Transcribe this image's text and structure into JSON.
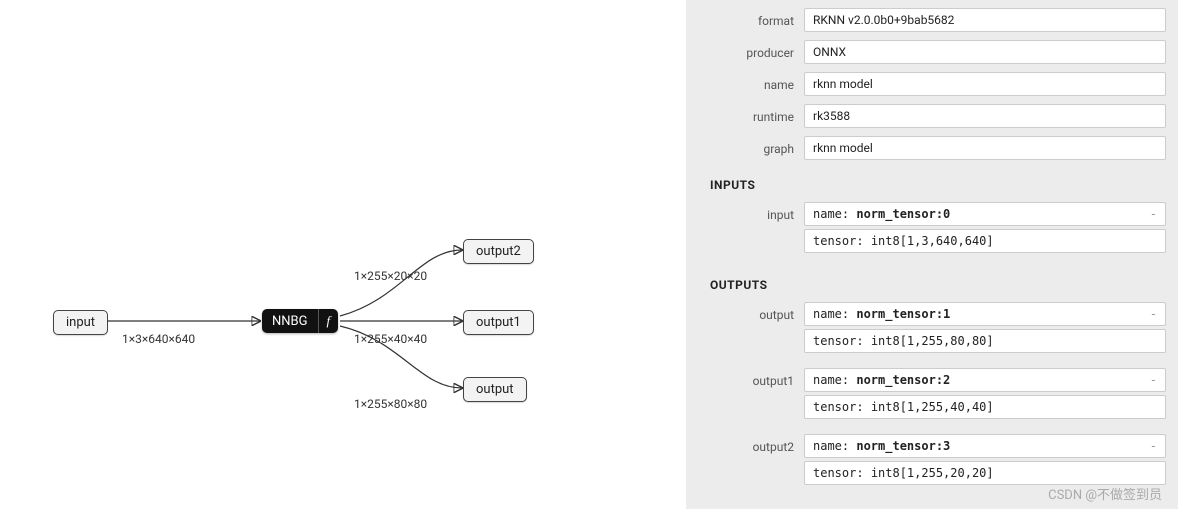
{
  "graph": {
    "input_node": "input",
    "op_node": "NNBG",
    "op_attr": "f",
    "outputs": [
      "output2",
      "output1",
      "output"
    ],
    "edge_in": "1×3×640×640",
    "edge_out": [
      "1×255×20×20",
      "1×255×40×40",
      "1×255×80×80"
    ]
  },
  "props": {
    "format_label": "format",
    "format": "RKNN v2.0.0b0+9bab5682",
    "producer_label": "producer",
    "producer": "ONNX",
    "name_label": "name",
    "name": "rknn model",
    "runtime_label": "runtime",
    "runtime": "rk3588",
    "graph_label": "graph",
    "graph": "rknn model"
  },
  "sections": {
    "inputs": "INPUTS",
    "outputs": "OUTPUTS"
  },
  "io_keys": {
    "name": "name:",
    "tensor": "tensor:"
  },
  "inputs": [
    {
      "label": "input",
      "name": "norm_tensor:0",
      "tensor": "int8[1,3,640,640]"
    }
  ],
  "outputs": [
    {
      "label": "output",
      "name": "norm_tensor:1",
      "tensor": "int8[1,255,80,80]"
    },
    {
      "label": "output1",
      "name": "norm_tensor:2",
      "tensor": "int8[1,255,40,40]"
    },
    {
      "label": "output2",
      "name": "norm_tensor:3",
      "tensor": "int8[1,255,20,20]"
    }
  ],
  "watermark": "CSDN @不做签到员"
}
